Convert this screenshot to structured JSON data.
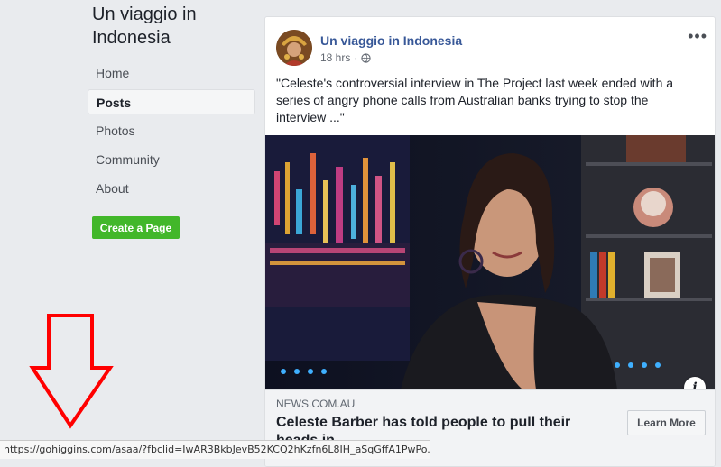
{
  "page": {
    "name": "Un viaggio in Indonesia"
  },
  "nav": {
    "items": [
      {
        "label": "Home",
        "active": false
      },
      {
        "label": "Posts",
        "active": true
      },
      {
        "label": "Photos",
        "active": false
      },
      {
        "label": "Community",
        "active": false
      },
      {
        "label": "About",
        "active": false
      }
    ],
    "create_page_label": "Create a Page"
  },
  "post": {
    "author": "Un viaggio in Indonesia",
    "time": "18 hrs",
    "privacy_icon": "globe-icon",
    "more_label": "•••",
    "text": "\"Celeste's controversial interview in The Project last week ended with a series of angry phone calls from Australian banks trying to stop the interview ...\"",
    "info_icon_label": "i",
    "link": {
      "domain": "NEWS.COM.AU",
      "headline": "Celeste Barber has told people to pull their heads in",
      "cta_label": "Learn More"
    }
  },
  "status_bar": {
    "url": "https://gohiggins.com/asaa/?fbclid=IwAR3BkbJevB52KCQ2hKzfn6L8IH_aSqGffA1PwPo..."
  },
  "colors": {
    "link_blue": "#385898",
    "green_button": "#42b72a",
    "annotation_red": "#ff0000",
    "background": "#e9ebee"
  }
}
